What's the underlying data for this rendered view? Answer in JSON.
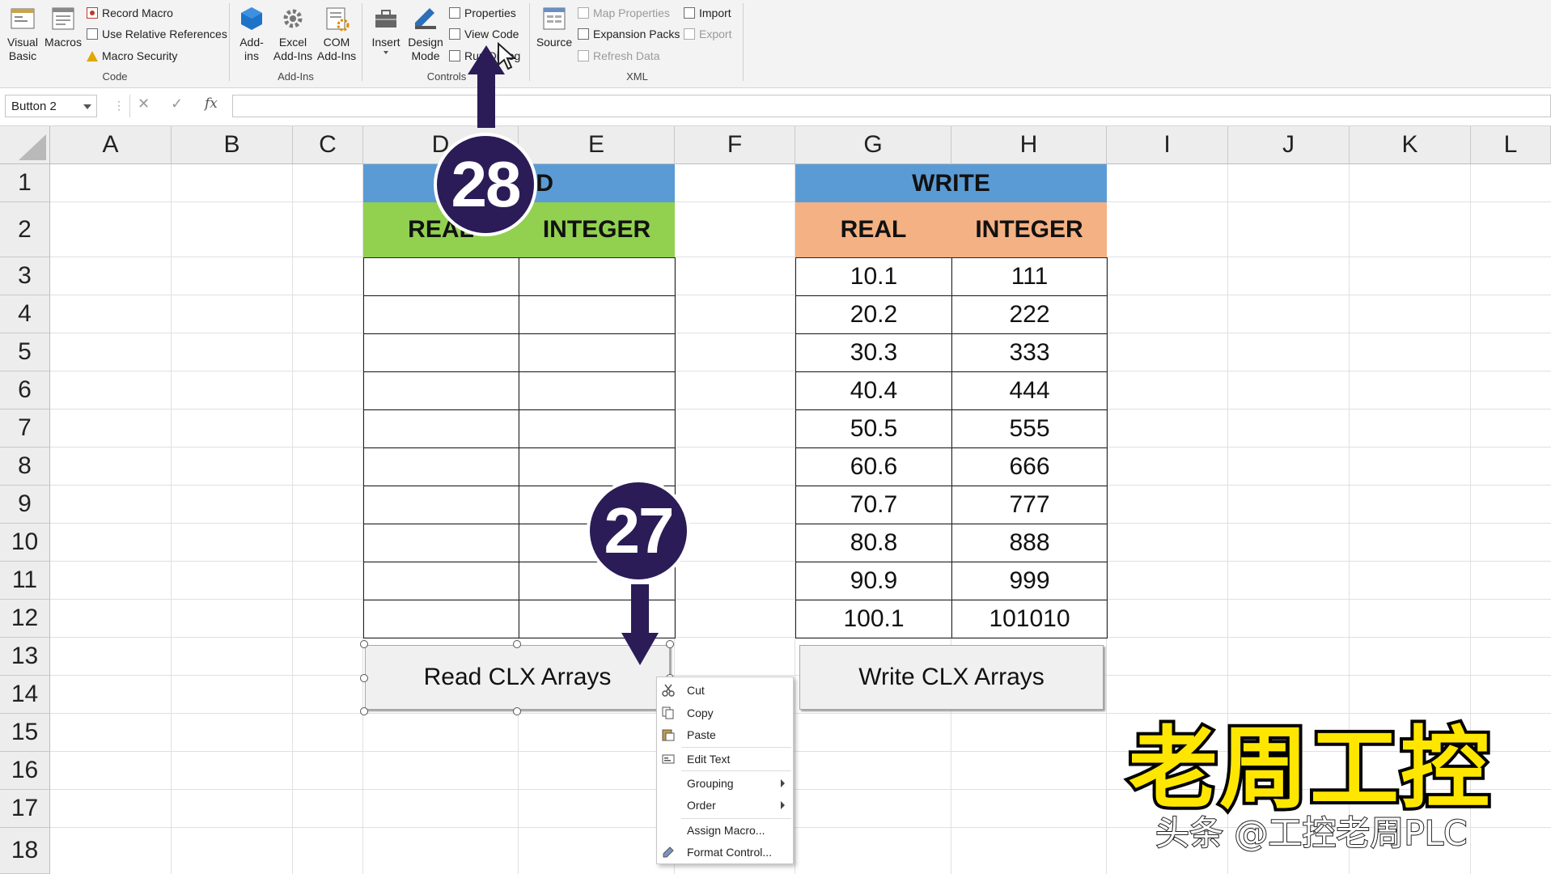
{
  "ribbon": {
    "code_group": {
      "visual_basic": "Visual\nBasic",
      "macros": "Macros",
      "record_macro": "Record Macro",
      "use_relative_references": "Use Relative References",
      "macro_security": "Macro Security",
      "label": "Code"
    },
    "addins_group": {
      "addins": "Add-\nins",
      "excel_addins": "Excel\nAdd-Ins",
      "com_addins": "COM\nAdd-Ins",
      "label": "Add-Ins"
    },
    "controls_group": {
      "insert": "Insert",
      "design_mode": "Design\nMode",
      "properties": "Properties",
      "view_code": "View Code",
      "run_dialog": "Run Dialog",
      "label": "Controls"
    },
    "xml_group": {
      "source": "Source",
      "map_properties": "Map Properties",
      "expansion_packs": "Expansion Packs",
      "refresh_data": "Refresh Data",
      "import": "Import",
      "export": "Export",
      "label": "XML"
    }
  },
  "formula_bar": {
    "name_box": "Button 2",
    "cancel_icon": "✕",
    "enter_icon": "✓",
    "fx_label": "fx",
    "value": ""
  },
  "columns": [
    "A",
    "B",
    "C",
    "D",
    "E",
    "F",
    "G",
    "H",
    "I",
    "J",
    "K",
    "L"
  ],
  "rows": [
    "1",
    "2",
    "3",
    "4",
    "5",
    "6",
    "7",
    "8",
    "9",
    "10",
    "11",
    "12",
    "13",
    "14",
    "15",
    "16",
    "17",
    "18"
  ],
  "read_table": {
    "title": "READ",
    "col1": "REAL",
    "col2": "INTEGER",
    "title_color": "#5b9bd5",
    "header_color": "#92d050"
  },
  "write_table": {
    "title": "WRITE",
    "col1": "REAL",
    "col2": "INTEGER",
    "title_color": "#5b9bd5",
    "header_color": "#f4b183",
    "real_values": [
      "10.1",
      "20.2",
      "30.3",
      "40.4",
      "50.5",
      "60.6",
      "70.7",
      "80.8",
      "90.9",
      "100.1"
    ],
    "integer_values": [
      "111",
      "222",
      "333",
      "444",
      "555",
      "666",
      "777",
      "888",
      "999",
      "101010"
    ]
  },
  "buttons": {
    "read": "Read CLX Arrays",
    "write": "Write CLX Arrays"
  },
  "context_menu": {
    "cut": "Cut",
    "copy": "Copy",
    "paste": "Paste",
    "edit_text": "Edit Text",
    "grouping": "Grouping",
    "order": "Order",
    "assign_macro": "Assign Macro...",
    "format_control": "Format Control..."
  },
  "annotations": {
    "step_28": "28",
    "step_27": "27",
    "badge_color": "#2b1c57"
  },
  "watermark": {
    "main": "老周工控",
    "sub": "头条 @工控老周PLC"
  }
}
